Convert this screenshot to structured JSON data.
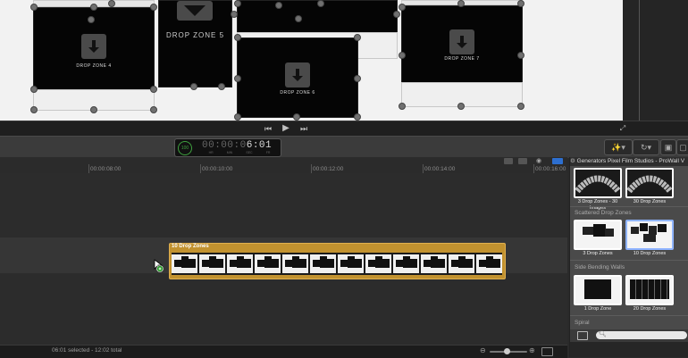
{
  "viewer": {
    "drop_zones": [
      {
        "label": "DROP ZONE 4"
      },
      {
        "label": "DROP ZONE 5"
      },
      {
        "label": "DROP ZONE 6"
      },
      {
        "label": "DROP ZONE 7"
      }
    ]
  },
  "transport": {
    "prev_icon": "skip-back-icon",
    "play_icon": "play-icon",
    "next_icon": "skip-forward-icon",
    "fullscreen_icon": "fullscreen-icon"
  },
  "toolbar": {
    "timecode_badge": "100",
    "timecode_dim": "00:00:0",
    "timecode_lit": "6:01",
    "timecode_units": [
      "HR",
      "MIN",
      "SEC",
      "FR"
    ]
  },
  "timeline": {
    "ruler_ticks": [
      "00:00:08:00",
      "00:00:10:00",
      "00:00:12:00",
      "00:00:14:00",
      "00:00:16:00"
    ],
    "clip_title": "10 Drop Zones",
    "clip_frame_count": 12,
    "status": "06:01 selected - 12:02 total"
  },
  "browser": {
    "header": "Generators   Pixel Film Studios - ProWall V",
    "items_top": [
      {
        "caption": "3 Drop Zones - 30 Images"
      },
      {
        "caption": "30 Drop Zones"
      }
    ],
    "categories": {
      "scattered": "Scattered Drop Zones",
      "side_bending": "Side Bending Walls",
      "spiral": "Spiral"
    },
    "scattered_items": [
      {
        "caption": "3 Drop Zones"
      },
      {
        "caption": "10 Drop Zones"
      }
    ],
    "side_items": [
      {
        "caption": "1 Drop Zone"
      },
      {
        "caption": "20 Drop Zones"
      }
    ]
  },
  "colors": {
    "clip": "#c2922f",
    "timecode_green": "#3fa03f"
  }
}
